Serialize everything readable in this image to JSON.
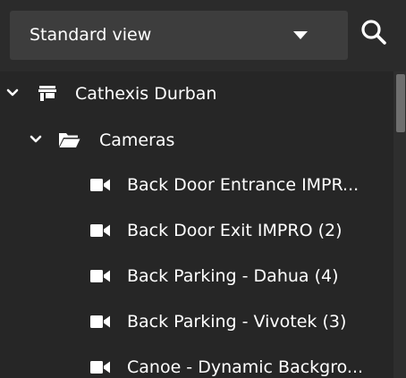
{
  "view_selector": {
    "label": "Standard view"
  },
  "tree": {
    "site": {
      "label": "Cathexis Durban",
      "icon": "store-icon",
      "expanded": true
    },
    "folder": {
      "label": "Cameras",
      "icon": "folder-icon",
      "expanded": true
    },
    "cameras": [
      {
        "label": "Back Door Entrance IMPR...",
        "icon": "video-camera-icon"
      },
      {
        "label": "Back Door Exit IMPRO (2)",
        "icon": "video-camera-icon"
      },
      {
        "label": "Back Parking - Dahua (4)",
        "icon": "video-camera-icon"
      },
      {
        "label": "Back Parking - Vivotek (3)",
        "icon": "video-camera-icon"
      },
      {
        "label": "Canoe - Dynamic Backgro...",
        "icon": "video-camera-icon"
      }
    ]
  },
  "colors": {
    "background": "#2b2b2b",
    "panel": "#262626",
    "selector": "#3d3d3d",
    "text": "#ffffff",
    "scrollbar_thumb": "#6e6e6e"
  }
}
